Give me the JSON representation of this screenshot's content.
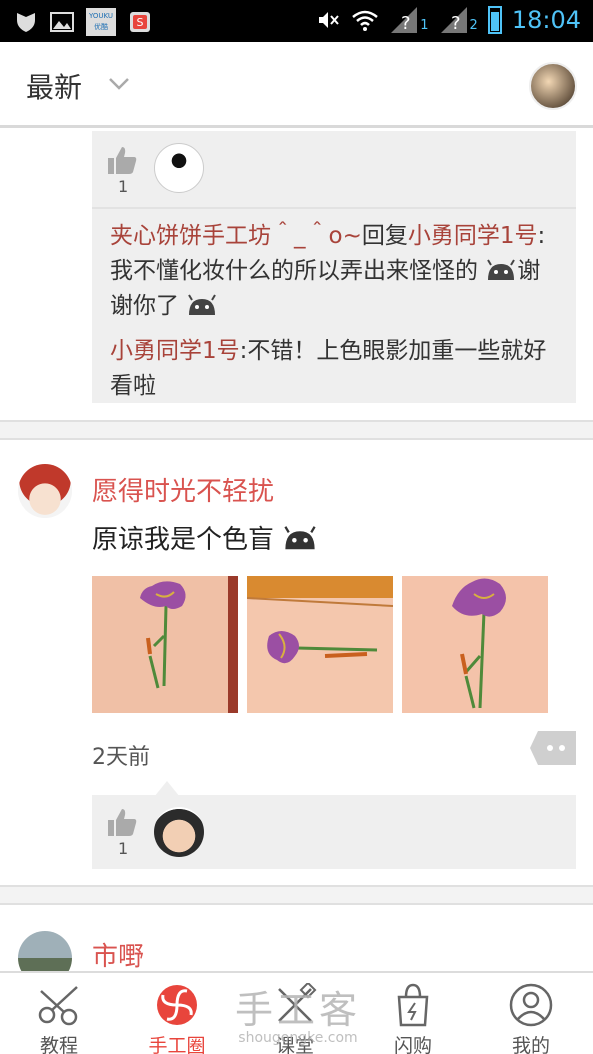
{
  "status_bar": {
    "time": "18:04",
    "icons": [
      "shield-icon",
      "image-icon",
      "youku-icon",
      "sogou-icon",
      "mute-icon",
      "wifi-icon",
      "signal-1-icon",
      "signal-2-icon",
      "battery-icon"
    ],
    "youku_text": "YOUKU 优酷",
    "sim1": "1",
    "sim2": "2"
  },
  "header": {
    "title": "最新"
  },
  "feed": {
    "post1_likes": {
      "count": "1"
    },
    "post1_replies": [
      {
        "name": "夹心饼饼手工坊＾_＾o~",
        "action": "回复",
        "target": "小勇同学1号",
        "text": ": 我不懂化妆什么的所以弄出来怪怪的",
        "text2": "谢谢你了"
      },
      {
        "name": "小勇同学1号",
        "text": ":不错！上色眼影加重一些就好看啦"
      }
    ],
    "post2": {
      "user": "愿得时光不轻扰",
      "text": "原谅我是个色盲",
      "time": "2天前",
      "likes": "1"
    },
    "post3": {
      "user": "市嘢"
    }
  },
  "bottom_nav": {
    "tabs": [
      {
        "label": "教程",
        "icon": "scissors-icon"
      },
      {
        "label": "手工圈",
        "icon": "flower-icon"
      },
      {
        "label": "课堂",
        "icon": "tools-icon"
      },
      {
        "label": "闪购",
        "icon": "shopping-bag-icon"
      },
      {
        "label": "我的",
        "icon": "profile-icon"
      }
    ],
    "active_index": 1,
    "watermark_big": "手工客",
    "watermark_small": "shougongke.com"
  },
  "colors": {
    "accent": "#e8453c",
    "username": "#d9534f",
    "reply_name": "#a8433a",
    "time_blue": "#4fc3f7"
  }
}
